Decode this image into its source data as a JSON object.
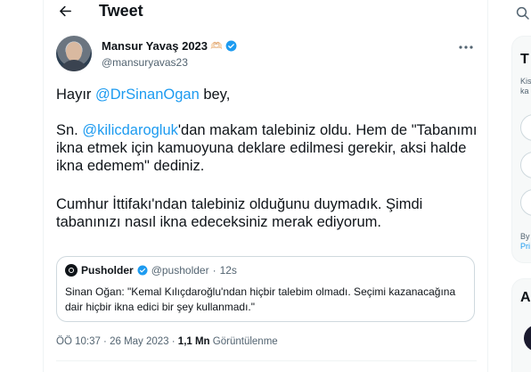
{
  "header": {
    "title": "Tweet"
  },
  "author": {
    "name": "Mansur Yavaş 2023",
    "name_emoji": "🫶🏻",
    "handle": "@mansuryavas23"
  },
  "tweet": {
    "p1_prefix": "Hayır ",
    "p1_mention": "@DrSinanOgan",
    "p1_suffix": " bey,",
    "p2_prefix": "Sn. ",
    "p2_mention": "@kilicdarogluk",
    "p2_suffix": "'dan makam talebiniz oldu. Hem de \"Tabanımı ikna etmek için kamuoyuna deklare edilmesi gerekir, aksi halde ikna edemem\" dediniz.",
    "p3": "Cumhur İttifakı'ndan talebiniz olduğunu duymadık. Şimdi tabanınızı nasıl ikna edeceksiniz merak ediyorum."
  },
  "quote": {
    "name": "Pusholder",
    "handle": "@pusholder",
    "dot": "·",
    "time": "12s",
    "text": "Sinan Oğan: \"Kemal Kılıçdaroğlu'ndan hiçbir talebim olmadı. Seçimi kazanacağına dair hiçbir ikna edici bir şey kullanmadı.\""
  },
  "meta": {
    "timestamp": "ÖÖ 10:37 · 26 May 2023 · ",
    "views_count": "1,1 Mn",
    "views_label": " Görüntülenme"
  },
  "sidebar": {
    "card1_letter": "T",
    "card1_small_1": "Kis",
    "card1_small_2": "ka",
    "card1_footer_1": "By",
    "card1_footer_2": "Pri",
    "card2_letter": "A"
  },
  "colors": {
    "accent": "#1d9bf0",
    "secondary_text": "#536471",
    "border": "#cfd9de"
  },
  "icons": {
    "back": "arrow-left-icon",
    "more": "more-horizontal-icon",
    "verified": "verified-badge-icon",
    "search": "search-icon"
  }
}
